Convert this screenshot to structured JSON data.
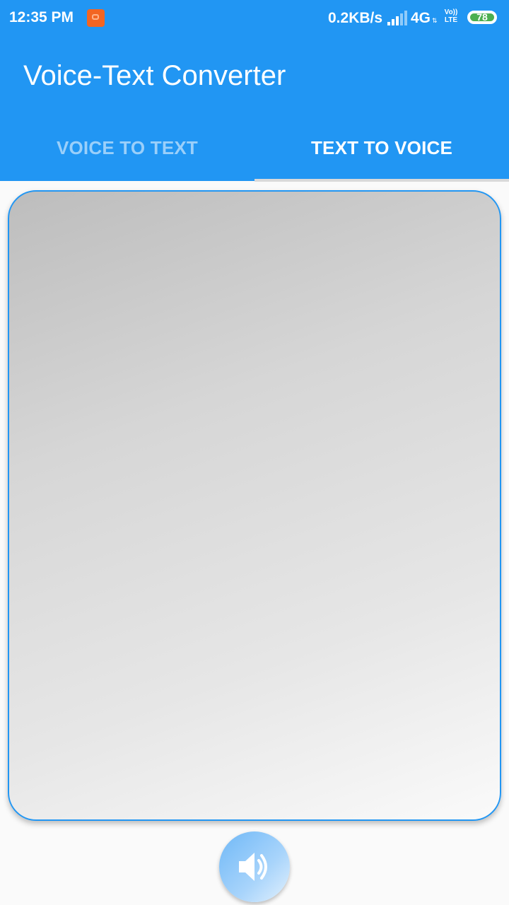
{
  "status_bar": {
    "time": "12:35 PM",
    "net_speed": "0.2KB/s",
    "network": "4G",
    "arrows": "⇅",
    "volte_top": "Vo))",
    "volte_bottom": "LTE",
    "battery": "78"
  },
  "app_bar": {
    "title": "Voice-Text Converter",
    "color": "#2196f3"
  },
  "tabs": [
    {
      "label": "VOICE TO TEXT",
      "selected": false
    },
    {
      "label": "TEXT TO VOICE",
      "selected": true
    }
  ],
  "text_area": {
    "value": "",
    "placeholder": ""
  },
  "speak_button": {
    "icon": "speaker-volume-icon"
  }
}
